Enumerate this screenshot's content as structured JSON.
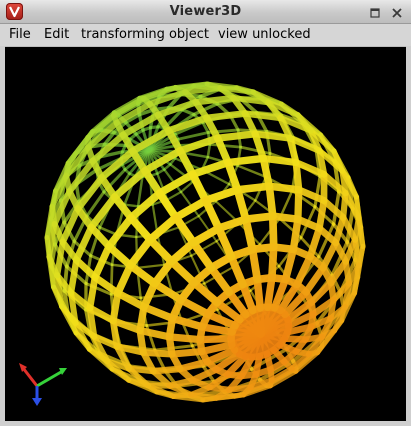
{
  "window": {
    "title": "Viewer3D",
    "app_icon": "viewer3d-logo-icon",
    "controls": [
      "maximize-icon",
      "close-icon"
    ]
  },
  "menubar": {
    "items": [
      "File",
      "Edit",
      "transforming object",
      "view unlocked"
    ]
  },
  "scene": {
    "background": "#000000",
    "object": "wireframe-sphere-tubes",
    "colors": [
      "#d42a10",
      "#f08a10",
      "#f3e21a",
      "#7bd23a",
      "#19b089"
    ],
    "axis_colors": {
      "x": "#e0302a",
      "y": "#36d23a",
      "z": "#2b4fe6"
    }
  }
}
